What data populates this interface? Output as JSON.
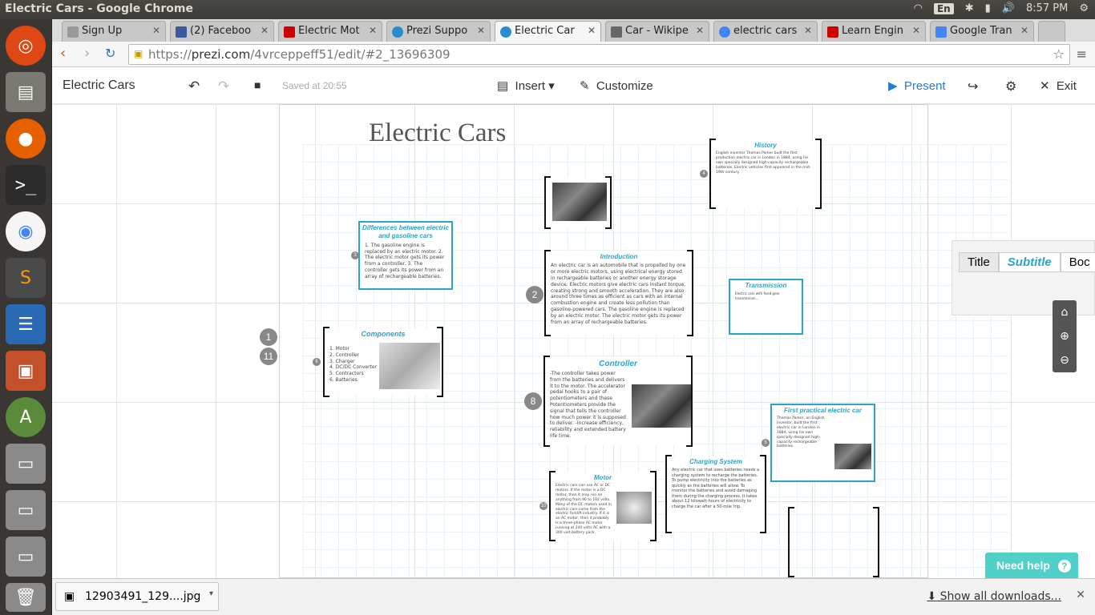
{
  "window": {
    "title": "Electric Cars - Google Chrome",
    "tray": {
      "lang": "En",
      "clock": "8:57 PM"
    }
  },
  "launcher": {
    "items": [
      "ubuntu-dash",
      "files",
      "firefox",
      "terminal",
      "chrome",
      "sublime-text",
      "libreoffice-writer",
      "libreoffice-impress",
      "software-updater",
      "drive-1",
      "drive-2",
      "drive-3",
      "trash"
    ]
  },
  "tabs": [
    {
      "label": "Sign Up",
      "fav": "#9a9a9a"
    },
    {
      "label": "(2) Faceboo",
      "fav": "#3b5998"
    },
    {
      "label": "Electric Mot",
      "fav": "#cc0000"
    },
    {
      "label": "Prezi Suppo",
      "fav": "#2a8cd0"
    },
    {
      "label": "Electric Car",
      "fav": "#2a8cd0"
    },
    {
      "label": "Car - Wikipe",
      "fav": "#666"
    },
    {
      "label": "electric cars",
      "fav": "#4285f4"
    },
    {
      "label": "Learn Engin",
      "fav": "#cc0000"
    },
    {
      "label": "Google Tran",
      "fav": "#4285f4"
    }
  ],
  "address": {
    "scheme": "https://",
    "domain": "prezi.com",
    "path": "/4vrceppeff51/edit/#2_13696309"
  },
  "prezi": {
    "title": "Electric Cars",
    "saved": "Saved at 20:55",
    "insert": "Insert",
    "customize": "Customize",
    "present": "Present",
    "exit": "Exit"
  },
  "canvas": {
    "main_title": "Electric Cars",
    "frames": {
      "differences": {
        "title": "Differences between electric and gasoline cars",
        "text": "1. The gasoline engine is replaced by an electric motor. 2. The electric motor gets its power from a controller. 3. The controller gets its power from an array of rechargeable batteries."
      },
      "introduction": {
        "title": "Introduction",
        "text": "An electric car is an automobile that is propelled by one or more electric motors, using electrical energy stored in rechargeable batteries or another energy storage device. Electric motors give electric cars instant torque, creating strong and smooth acceleration. They are also around three times as efficient as cars with an internal combustion engine and create less pollution than gasoline-powered cars. The gasoline engine is replaced by an electric motor. The electric motor gets its power from an array of rechargeable batteries."
      },
      "history": {
        "title": "History",
        "text": "English inventor Thomas Parker built the first production electric car in London in 1884, using his own specially designed high-capacity rechargeable batteries. Electric vehicles first appeared in the mid-19th century."
      },
      "transmission": {
        "title": "Transmission",
        "text": "Electric cars with fixed gear transmission..."
      },
      "components": {
        "title": "Components",
        "items": [
          "1. Motor",
          "2. Controller",
          "3. Charger",
          "4. DC/DC Converter",
          "5. Contractors",
          "6. Batteries"
        ]
      },
      "controller": {
        "title": "Controller",
        "text": "-The controller takes power from the batteries and delivers it to the motor. The accelerator pedal hooks to a pair of potentiometers and these Potentiometers provide the signal that tells the controller how much power it is supposed to deliver. -Increase efficiency, reliability and extended battery life time."
      },
      "first_practical": {
        "title": "First practical electric car",
        "text": "Thomas Parker, an English inventor, built the first electric car in London in 1884, using his own specially designed high-capacity rechargeable batteries."
      },
      "motor": {
        "title": "Motor",
        "text": "Electric cars can use AC or DC motors. If the motor is a DC motor, then it may run on anything from 96 to 192 volts. Many of the DC motors used in electric cars come from the electric forklift industry. If it is an AC motor, then it probably is a three-phase AC motor running at 240 volts AC with a 300 volt battery pack."
      },
      "charging": {
        "title": "Charging System",
        "text": "Any electric car that uses batteries needs a charging system to recharge the batteries. To pump electricity into the batteries as quickly as the batteries will allow. To monitor the batteries and avoid damaging them during the charging process. It takes about 12 kilowatt-hours of electricity to charge the car after a 50-mile trip."
      }
    },
    "step_numbers": {
      "n1": "1",
      "n11": "11",
      "n2": "2",
      "n8": "8",
      "n4": "4",
      "n5": "5",
      "n6": "6",
      "n10": "10",
      "n3": "3"
    }
  },
  "text_panel": {
    "tab_title": "Title",
    "tab_subtitle": "Subtitle",
    "tab_body": "Boc"
  },
  "help": {
    "label": "Need help",
    "icon": "?"
  },
  "downloads": {
    "file": "12903491_129....jpg",
    "show_all": "Show all downloads..."
  }
}
